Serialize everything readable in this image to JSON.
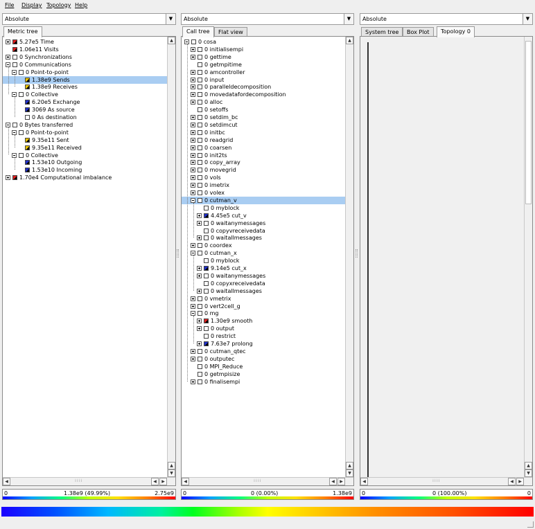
{
  "menu": [
    "File",
    "Display",
    "Topology",
    "Help"
  ],
  "metric_pane": {
    "combo": "Absolute",
    "tabs": [
      "Metric tree"
    ],
    "items": [
      {
        "label": "5.27e5 Time",
        "d": 0,
        "exp": "plus",
        "color": "#e02020"
      },
      {
        "label": "1.06e11 Visits",
        "d": 0,
        "exp": "none",
        "color": "#e02020"
      },
      {
        "label": "0 Synchronizations",
        "d": 0,
        "exp": "plus",
        "color": ""
      },
      {
        "label": "0 Communications",
        "d": 0,
        "exp": "minus",
        "color": ""
      },
      {
        "label": "0 Point-to-point",
        "d": 1,
        "exp": "minus",
        "color": ""
      },
      {
        "label": "1.38e9 Sends",
        "d": 2,
        "exp": "none",
        "color": "#e8c200",
        "sel": true
      },
      {
        "label": "1.38e9 Receives",
        "d": 2,
        "exp": "none",
        "color": "#e8c200"
      },
      {
        "label": "0 Collective",
        "d": 1,
        "exp": "minus",
        "color": ""
      },
      {
        "label": "6.20e5 Exchange",
        "d": 2,
        "exp": "none",
        "color": "#2030c8"
      },
      {
        "label": "3069 As source",
        "d": 2,
        "exp": "none",
        "color": "#2030c8"
      },
      {
        "label": "0 As destination",
        "d": 2,
        "exp": "none",
        "color": ""
      },
      {
        "label": "0 Bytes transferred",
        "d": 0,
        "exp": "minus",
        "color": ""
      },
      {
        "label": "0 Point-to-point",
        "d": 1,
        "exp": "minus",
        "color": ""
      },
      {
        "label": "9.35e11 Sent",
        "d": 2,
        "exp": "none",
        "color": "#e8c200"
      },
      {
        "label": "9.35e11 Received",
        "d": 2,
        "exp": "none",
        "color": "#e8c200"
      },
      {
        "label": "0 Collective",
        "d": 1,
        "exp": "minus",
        "color": ""
      },
      {
        "label": "1.53e10 Outgoing",
        "d": 2,
        "exp": "none",
        "color": "#2030c8"
      },
      {
        "label": "1.53e10 Incoming",
        "d": 2,
        "exp": "none",
        "color": "#2030c8"
      },
      {
        "label": "1.70e4 Computational imbalance",
        "d": 0,
        "exp": "plus",
        "color": "#e02020"
      }
    ],
    "scale_min": "0",
    "scale_mid": "1.38e9 (49.99%)",
    "scale_max": "2.75e9"
  },
  "call_pane": {
    "combo": "Absolute",
    "tabs": [
      "Call tree",
      "Flat view"
    ],
    "items": [
      {
        "label": "0 cosa",
        "d": 0,
        "exp": "minus",
        "color": ""
      },
      {
        "label": "0 initialisempi",
        "d": 1,
        "exp": "plus",
        "color": ""
      },
      {
        "label": "0 gettime",
        "d": 1,
        "exp": "plus",
        "color": ""
      },
      {
        "label": "0 getmpitime",
        "d": 1,
        "exp": "none",
        "color": ""
      },
      {
        "label": "0 amcontroller",
        "d": 1,
        "exp": "plus",
        "color": ""
      },
      {
        "label": "0 input",
        "d": 1,
        "exp": "plus",
        "color": ""
      },
      {
        "label": "0 paralleldecomposition",
        "d": 1,
        "exp": "plus",
        "color": ""
      },
      {
        "label": "0 movedatafordecomposition",
        "d": 1,
        "exp": "plus",
        "color": ""
      },
      {
        "label": "0 alloc",
        "d": 1,
        "exp": "plus",
        "color": ""
      },
      {
        "label": "0 setoffs",
        "d": 1,
        "exp": "none",
        "color": ""
      },
      {
        "label": "0 setdim_bc",
        "d": 1,
        "exp": "plus",
        "color": ""
      },
      {
        "label": "0 setdimcut",
        "d": 1,
        "exp": "plus",
        "color": ""
      },
      {
        "label": "0 initbc",
        "d": 1,
        "exp": "plus",
        "color": ""
      },
      {
        "label": "0 readgrid",
        "d": 1,
        "exp": "plus",
        "color": ""
      },
      {
        "label": "0 coarsen",
        "d": 1,
        "exp": "plus",
        "color": ""
      },
      {
        "label": "0 init2ts",
        "d": 1,
        "exp": "plus",
        "color": ""
      },
      {
        "label": "0 copy_array",
        "d": 1,
        "exp": "plus",
        "color": ""
      },
      {
        "label": "0 movegrid",
        "d": 1,
        "exp": "plus",
        "color": ""
      },
      {
        "label": "0 vols",
        "d": 1,
        "exp": "plus",
        "color": ""
      },
      {
        "label": "0 imetrix",
        "d": 1,
        "exp": "plus",
        "color": ""
      },
      {
        "label": "0 volex",
        "d": 1,
        "exp": "plus",
        "color": ""
      },
      {
        "label": "0 cutman_v",
        "d": 1,
        "exp": "minus",
        "color": "",
        "sel": true
      },
      {
        "label": "0 myblock",
        "d": 2,
        "exp": "none",
        "color": ""
      },
      {
        "label": "4.45e5 cut_v",
        "d": 2,
        "exp": "plus",
        "color": "#2030c8"
      },
      {
        "label": "0 waitanymessages",
        "d": 2,
        "exp": "plus",
        "color": ""
      },
      {
        "label": "0 copyvreceivedata",
        "d": 2,
        "exp": "none",
        "color": ""
      },
      {
        "label": "0 waitallmessages",
        "d": 2,
        "exp": "plus",
        "color": ""
      },
      {
        "label": "0 coordex",
        "d": 1,
        "exp": "plus",
        "color": ""
      },
      {
        "label": "0 cutman_x",
        "d": 1,
        "exp": "minus",
        "color": ""
      },
      {
        "label": "0 myblock",
        "d": 2,
        "exp": "none",
        "color": ""
      },
      {
        "label": "9.14e5 cut_x",
        "d": 2,
        "exp": "plus",
        "color": "#2030c8"
      },
      {
        "label": "0 waitanymessages",
        "d": 2,
        "exp": "plus",
        "color": ""
      },
      {
        "label": "0 copyxreceivedata",
        "d": 2,
        "exp": "none",
        "color": ""
      },
      {
        "label": "0 waitallmessages",
        "d": 2,
        "exp": "plus",
        "color": ""
      },
      {
        "label": "0 vmetrix",
        "d": 1,
        "exp": "plus",
        "color": ""
      },
      {
        "label": "0 vert2cell_g",
        "d": 1,
        "exp": "plus",
        "color": ""
      },
      {
        "label": "0 mg",
        "d": 1,
        "exp": "minus",
        "color": ""
      },
      {
        "label": "1.30e9 smooth",
        "d": 2,
        "exp": "plus",
        "color": "#e02020"
      },
      {
        "label": "0 output",
        "d": 2,
        "exp": "plus",
        "color": ""
      },
      {
        "label": "0 restrict",
        "d": 2,
        "exp": "none",
        "color": ""
      },
      {
        "label": "7.63e7 prolong",
        "d": 2,
        "exp": "plus",
        "color": "#2030c8"
      },
      {
        "label": "0 cutman_qtec",
        "d": 1,
        "exp": "plus",
        "color": ""
      },
      {
        "label": "0 outputec",
        "d": 1,
        "exp": "plus",
        "color": ""
      },
      {
        "label": "0 MPI_Reduce",
        "d": 1,
        "exp": "none",
        "color": ""
      },
      {
        "label": "0 getmpisize",
        "d": 1,
        "exp": "none",
        "color": ""
      },
      {
        "label": "0 finalisempi",
        "d": 1,
        "exp": "plus",
        "color": ""
      }
    ],
    "scale_min": "0",
    "scale_mid": "0 (0.00%)",
    "scale_max": "1.38e9"
  },
  "system_pane": {
    "combo": "Absolute",
    "tabs": [
      "System tree",
      "Box Plot",
      "Topology 0"
    ],
    "scale_min": "0",
    "scale_mid": "0 (100.00%)",
    "scale_max": "0"
  }
}
